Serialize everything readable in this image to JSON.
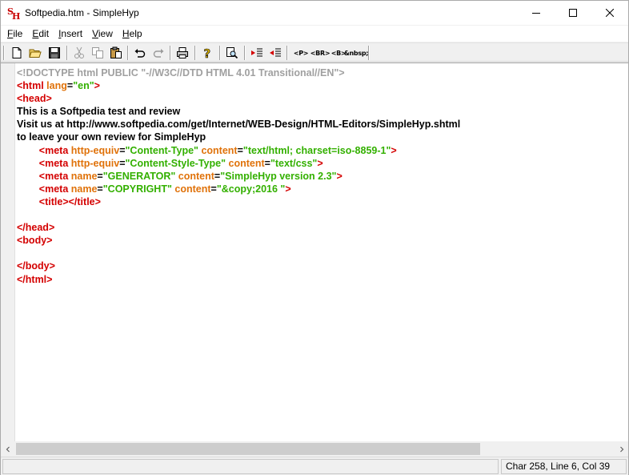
{
  "window": {
    "title": "Softpedia.htm - SimpleHyp"
  },
  "menu": [
    {
      "label": "File",
      "accel": "F",
      "rest": "ile"
    },
    {
      "label": "Edit",
      "accel": "E",
      "rest": "dit"
    },
    {
      "label": "Insert",
      "accel": "I",
      "rest": "nsert"
    },
    {
      "label": "View",
      "accel": "V",
      "rest": "iew"
    },
    {
      "label": "Help",
      "accel": "H",
      "rest": "elp"
    }
  ],
  "toolbar": {
    "tags": [
      "<P>",
      "<BR>",
      "<B>",
      "&nbsp;"
    ],
    "icons": [
      "new-file-icon",
      "open-folder-icon",
      "save-icon",
      "cut-icon",
      "copy-icon",
      "paste-icon",
      "undo-icon",
      "redo-icon",
      "print-icon",
      "help-icon",
      "find-icon",
      "indent-icon",
      "outdent-icon"
    ]
  },
  "editor": {
    "lines": [
      [
        {
          "t": "<!DOCTYPE html PUBLIC \"-//W3C//DTD HTML 4.01 Transitional//EN\">",
          "c": "doctype"
        }
      ],
      [
        {
          "t": "<html ",
          "c": "tag"
        },
        {
          "t": "lang",
          "c": "attr"
        },
        {
          "t": "=",
          "c": "eq"
        },
        {
          "t": "\"en\"",
          "c": "val"
        },
        {
          "t": ">",
          "c": "tag"
        }
      ],
      [
        {
          "t": "<head>",
          "c": "tag"
        }
      ],
      [
        {
          "t": "This is a Softpedia test and review",
          "c": "text"
        }
      ],
      [
        {
          "t": "Visit us at http://www.softpedia.com/get/Internet/WEB-Design/HTML-Editors/SimpleHyp.shtml",
          "c": "text"
        }
      ],
      [
        {
          "t": "to leave your own review for SimpleHyp",
          "c": "text"
        }
      ],
      [
        {
          "t": "        ",
          "c": "text"
        },
        {
          "t": "<meta ",
          "c": "tag"
        },
        {
          "t": "http-equiv",
          "c": "attr"
        },
        {
          "t": "=",
          "c": "eq"
        },
        {
          "t": "\"Content-Type\"",
          "c": "val"
        },
        {
          "t": " content",
          "c": "attr"
        },
        {
          "t": "=",
          "c": "eq"
        },
        {
          "t": "\"text/html; charset=iso-8859-1\"",
          "c": "val"
        },
        {
          "t": ">",
          "c": "tag"
        }
      ],
      [
        {
          "t": "        ",
          "c": "text"
        },
        {
          "t": "<meta ",
          "c": "tag"
        },
        {
          "t": "http-equiv",
          "c": "attr"
        },
        {
          "t": "=",
          "c": "eq"
        },
        {
          "t": "\"Content-Style-Type\"",
          "c": "val"
        },
        {
          "t": " content",
          "c": "attr"
        },
        {
          "t": "=",
          "c": "eq"
        },
        {
          "t": "\"text/css\"",
          "c": "val"
        },
        {
          "t": ">",
          "c": "tag"
        }
      ],
      [
        {
          "t": "        ",
          "c": "text"
        },
        {
          "t": "<meta ",
          "c": "tag"
        },
        {
          "t": "name",
          "c": "attr"
        },
        {
          "t": "=",
          "c": "eq"
        },
        {
          "t": "\"GENERATOR\"",
          "c": "val"
        },
        {
          "t": " content",
          "c": "attr"
        },
        {
          "t": "=",
          "c": "eq"
        },
        {
          "t": "\"SimpleHyp version 2.3\"",
          "c": "val"
        },
        {
          "t": ">",
          "c": "tag"
        }
      ],
      [
        {
          "t": "        ",
          "c": "text"
        },
        {
          "t": "<meta ",
          "c": "tag"
        },
        {
          "t": "name",
          "c": "attr"
        },
        {
          "t": "=",
          "c": "eq"
        },
        {
          "t": "\"COPYRIGHT\"",
          "c": "val"
        },
        {
          "t": " content",
          "c": "attr"
        },
        {
          "t": "=",
          "c": "eq"
        },
        {
          "t": "\"&copy;2016 \"",
          "c": "val"
        },
        {
          "t": ">",
          "c": "tag"
        }
      ],
      [
        {
          "t": "        ",
          "c": "text"
        },
        {
          "t": "<title></title>",
          "c": "tag"
        }
      ],
      [],
      [
        {
          "t": "</head>",
          "c": "tag"
        }
      ],
      [
        {
          "t": "<body>",
          "c": "tag"
        }
      ],
      [],
      [
        {
          "t": "</body>",
          "c": "tag"
        }
      ],
      [
        {
          "t": "</html>",
          "c": "tag"
        }
      ]
    ]
  },
  "statusbar": {
    "position": "Char 258, Line 6, Col 39"
  }
}
